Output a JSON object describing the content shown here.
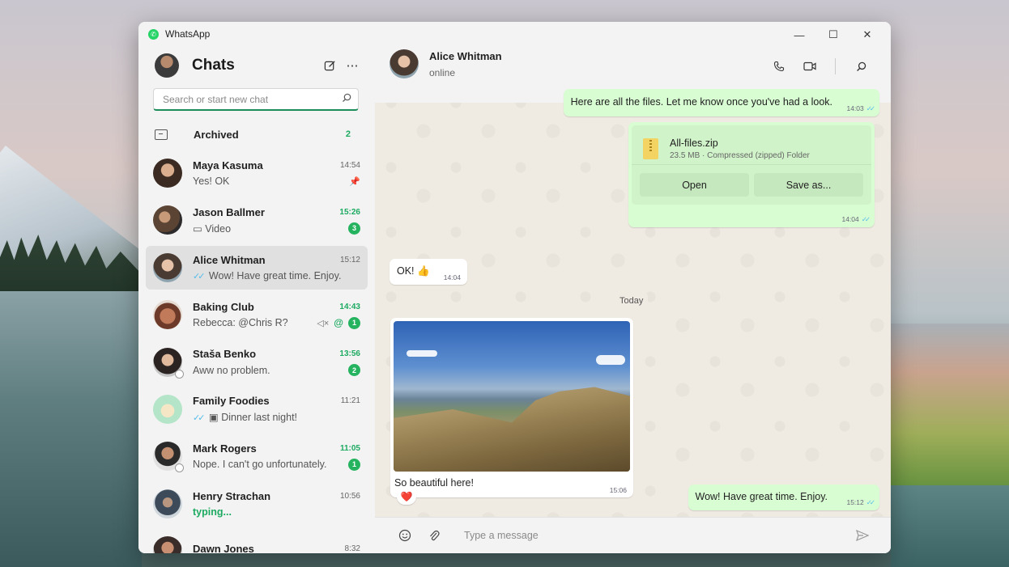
{
  "app": {
    "title": "WhatsApp"
  },
  "sidebar": {
    "title": "Chats",
    "new_chat_icon": "compose-icon",
    "more_icon": "ellipsis-icon",
    "search_placeholder": "Search or start new chat",
    "archived": {
      "label": "Archived",
      "count": "2"
    },
    "chats": [
      {
        "name": "Maya Kasuma",
        "time": "14:54",
        "preview": "Yes! OK",
        "unread": "",
        "pinned": true
      },
      {
        "name": "Jason Ballmer",
        "time": "15:26",
        "preview": "Video",
        "unread": "3"
      },
      {
        "name": "Alice Whitman",
        "time": "15:12",
        "preview": "Wow! Have great time. Enjoy.",
        "unread": "",
        "active": true
      },
      {
        "name": "Baking Club",
        "time": "14:43",
        "preview": "Rebecca: @Chris R?",
        "unread": "1",
        "muted": true,
        "mention": "@"
      },
      {
        "name": "Staša Benko",
        "time": "13:56",
        "preview": "Aww no problem.",
        "unread": "2"
      },
      {
        "name": "Family Foodies",
        "time": "11:21",
        "preview": "Dinner last night!",
        "unread": ""
      },
      {
        "name": "Mark Rogers",
        "time": "11:05",
        "preview": "Nope. I can't go unfortunately.",
        "unread": "1"
      },
      {
        "name": "Henry Strachan",
        "time": "10:56",
        "preview": "typing...",
        "unread": ""
      },
      {
        "name": "Dawn Jones",
        "time": "8:32",
        "preview": "",
        "unread": ""
      }
    ]
  },
  "conversation": {
    "contact_name": "Alice Whitman",
    "contact_status": "online",
    "messages": {
      "m1": {
        "text": "Here are all the files. Let me know once you've had a look.",
        "time": "14:03"
      },
      "file": {
        "name": "All-files.zip",
        "meta": "23.5 MB · Compressed (zipped) Folder",
        "open_label": "Open",
        "save_label": "Save as...",
        "time": "14:04"
      },
      "ok": {
        "text": "OK! 👍",
        "time": "14:04"
      },
      "day": "Today",
      "photo": {
        "caption": "So beautiful here!",
        "time": "15:06",
        "reaction": "❤️"
      },
      "last": {
        "text": "Wow! Have great time. Enjoy.",
        "time": "15:12"
      }
    },
    "composer_placeholder": "Type a message"
  },
  "colors": {
    "accent": "#1daa61",
    "outgoing": "#d9fdd3",
    "incoming": "#ffffff"
  }
}
